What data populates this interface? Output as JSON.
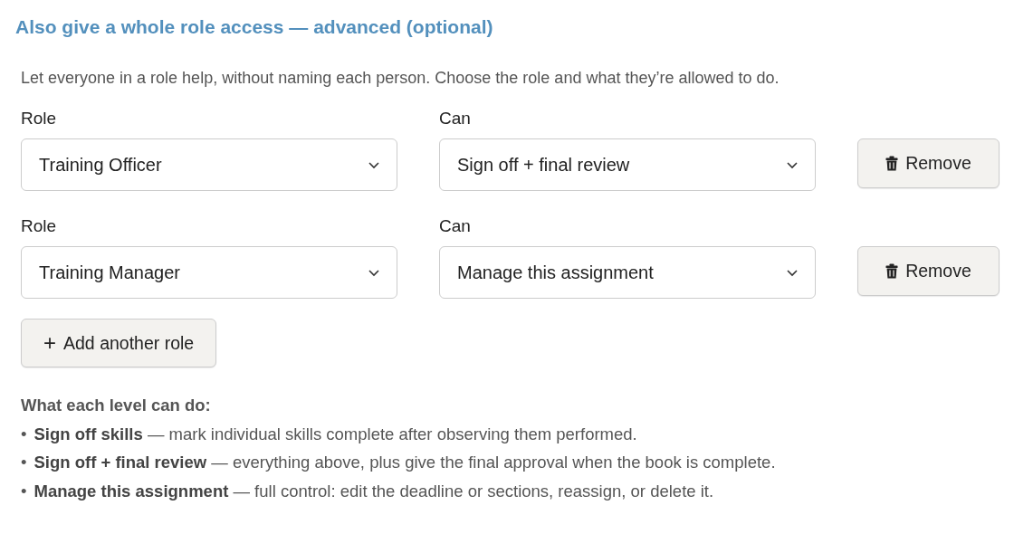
{
  "heading": "Also give a whole role access — advanced (optional)",
  "description": "Let everyone in a role help, without naming each person. Choose the role and what they’re allowed to do.",
  "assignments": [
    {
      "role_label": "Role",
      "role": "Training Officer",
      "can_label": "Can",
      "can": "Sign off + final review",
      "remove": "Remove"
    },
    {
      "role_label": "Role",
      "role": "Training Manager",
      "can_label": "Can",
      "can": "Manage this assignment",
      "remove": "Remove"
    }
  ],
  "add_button": {
    "icon": "+",
    "label": "Add another role"
  },
  "help": {
    "title": "What each level can do:",
    "items": [
      {
        "marker": "•",
        "text": "**Sign off skills** — mark individual skills complete after observing them performed."
      },
      {
        "marker": "•",
        "text": "**Sign off + final review** — everything above, plus give the final approval when the book is complete."
      },
      {
        "marker": "•",
        "text": "**Manage this assignment** — full control: edit the deadline or sections, reassign, or delete it."
      }
    ]
  }
}
